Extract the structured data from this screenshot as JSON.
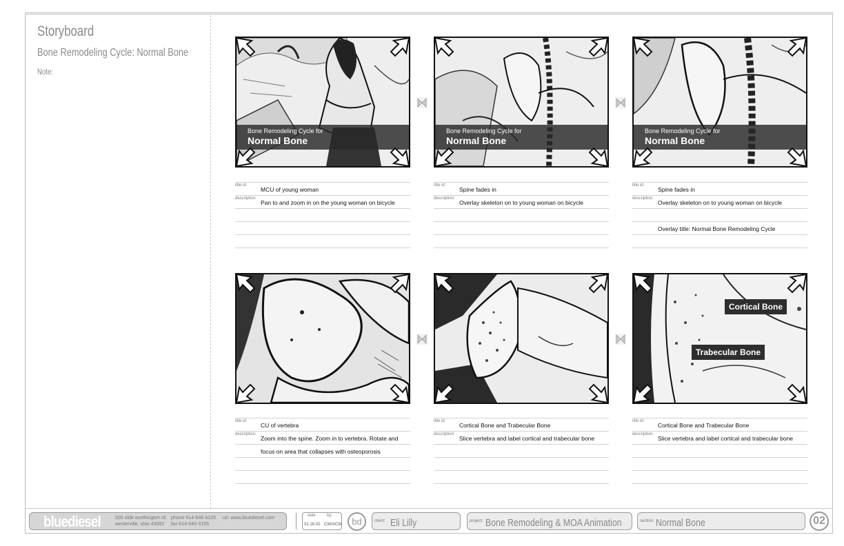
{
  "sidebar": {
    "title": "Storyboard",
    "subtitle": "Bone Remodeling Cycle: Normal Bone",
    "note_label": "Note:"
  },
  "overlay_title": {
    "small": "Bone Remodeling Cycle for",
    "big": "Normal Bone"
  },
  "callouts": {
    "cortical": "Cortical Bone",
    "trabecular": "Trabecular Bone"
  },
  "field_labels": {
    "title": "title id:",
    "description": "description:"
  },
  "frames": [
    {
      "title": "MCU of young woman",
      "lines": [
        "Pan to and zoom in on the young woman on bicycle",
        "",
        "",
        ""
      ]
    },
    {
      "title": "Spine fades in",
      "lines": [
        "Overlay skeleton on to young woman on bicycle",
        "",
        "",
        ""
      ]
    },
    {
      "title": "Spine fades in",
      "lines": [
        "Overlay skeleton on to young woman on bicycle",
        "",
        "Overlay title: Normal Bone Remodeling Cycle",
        ""
      ]
    },
    {
      "title": "CU of vertebra",
      "lines": [
        "Zoom into the spine. Zoom in to vertebra. Rotate and",
        "focus on area that collapses with osteoporosis",
        "",
        ""
      ]
    },
    {
      "title": "Cortical Bone and Trabecular Bone",
      "lines": [
        "Slice vertebra and label cortical and trabecular bone",
        "",
        "",
        ""
      ]
    },
    {
      "title": "Cortical Bone and Trabecular Bone",
      "lines": [
        "Slice vertebra and label cortical and trabecular bone",
        "",
        "",
        ""
      ]
    }
  ],
  "footer": {
    "logo": "bluediesel",
    "address1": "500 olde worthington rd",
    "address2": "westerville, ohio 43082",
    "phone": "phone  614-546-4226",
    "fax": "fax  614-540-3155",
    "url": "url: www.bluediesel.com",
    "date_label": "date",
    "date_value": "01.16.02",
    "by_label": "by:",
    "by_value": "CW/ACW",
    "bd_mark": "bd",
    "client_label": "client:",
    "client_value": "Eli Lilly",
    "project_label": "project:",
    "project_value": "Bone Remodeling & MOA Animation",
    "section_label": "section:",
    "section_value": "Normal Bone",
    "page_number": "02"
  },
  "colors": {
    "frame_border": "#111111",
    "overlay": "#282828",
    "rule": "#d2d2d2",
    "gray_text": "#8a8a8a"
  }
}
